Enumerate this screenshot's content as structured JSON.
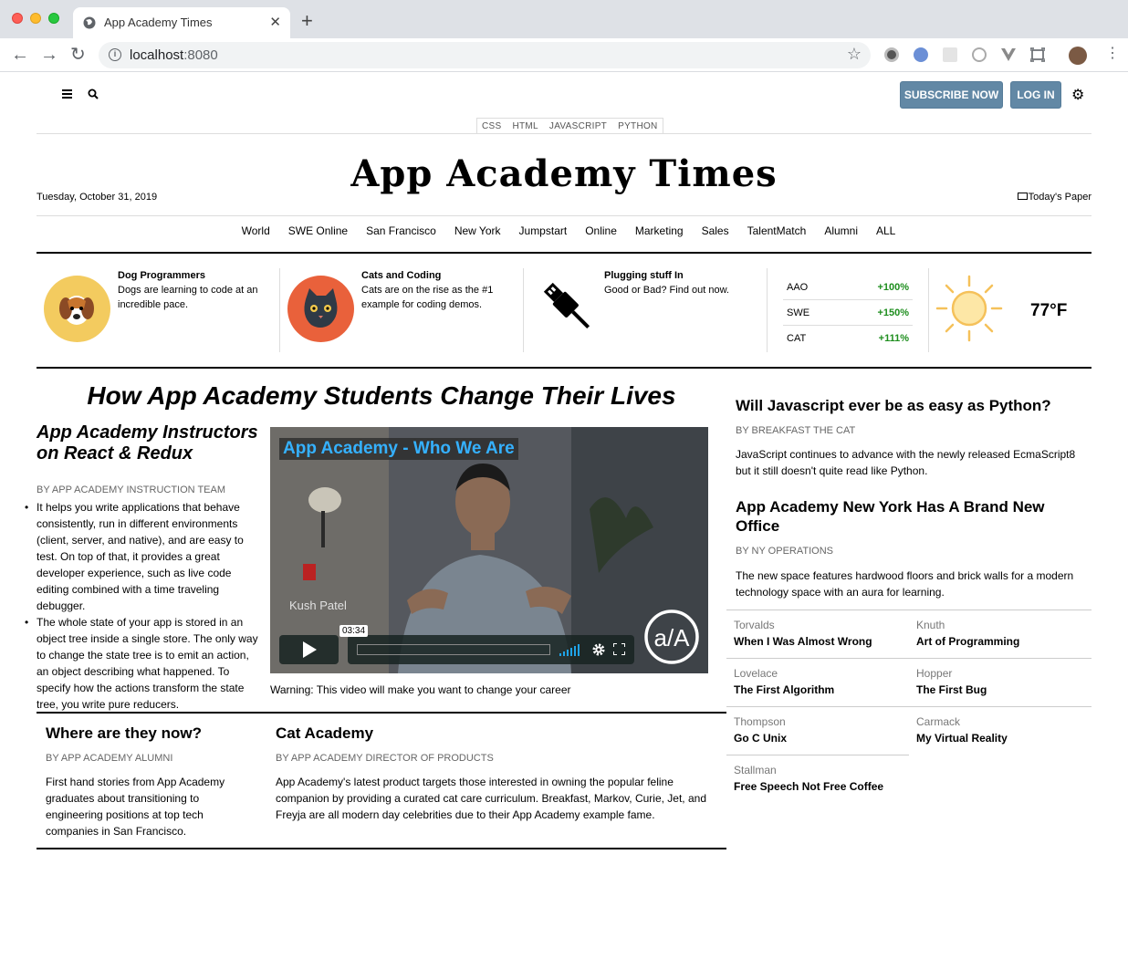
{
  "browser": {
    "tab_title": "App Academy Times",
    "tab_close": "✕",
    "new_tab": "+",
    "url_host": "localhost",
    "url_port": ":8080",
    "back": "←",
    "forward": "→",
    "reload": "↻",
    "star": "☆",
    "menu": "⋮"
  },
  "header": {
    "menu_icon": "≡",
    "search_icon": "⌕",
    "subscribe_label": "SUBSCRIBE NOW",
    "login_label": "LOG IN",
    "settings_icon": "⚙"
  },
  "languages": [
    "CSS",
    "HTML",
    "JAVASCRIPT",
    "PYTHON"
  ],
  "masthead": {
    "title": "App Academy Times",
    "date": "Tuesday, October 31, 2019",
    "todays_paper": "Today's Paper"
  },
  "sections": [
    "World",
    "SWE Online",
    "San Francisco",
    "New York",
    "Jumpstart",
    "Online",
    "Marketing",
    "Sales",
    "TalentMatch",
    "Alumni",
    "ALL"
  ],
  "strip": [
    {
      "title": "Dog Programmers",
      "desc": "Dogs are learning to code at an incredible pace.",
      "icon": "dog-icon"
    },
    {
      "title": "Cats and Coding",
      "desc": "Cats are on the rise as the #1 example for coding demos.",
      "icon": "cat-icon"
    },
    {
      "title": "Plugging stuff In",
      "desc": "Good or Bad? Find out now.",
      "icon": "usb-plug-icon"
    }
  ],
  "markets": [
    {
      "ticker": "AAO",
      "change": "+100%"
    },
    {
      "ticker": "SWE",
      "change": "+150%"
    },
    {
      "ticker": "CAT",
      "change": "+111%"
    }
  ],
  "weather": {
    "temp": "77°F",
    "icon": "sun-icon"
  },
  "main": {
    "headline": "How App Academy Students Change Their Lives",
    "sub_headline": "App Academy Instructors on React & Redux",
    "byline": "By APP ACADEMY INSTRUCTION TEAM",
    "bullets": [
      "It helps you write applications that behave consistently, run in different environments (client, server, and native), and are easy to test. On top of that, it provides a great developer experience, such as live code editing combined with a time traveling debugger.",
      "The whole state of your app is stored in an object tree inside a single store. The only way to change the state tree is to emit an action, an object describing what happened. To specify how the actions transform the state tree, you write pure reducers."
    ],
    "video": {
      "title": "App Academy - Who We Are",
      "speaker": "Kush Patel",
      "timecode": "03:34",
      "logo": "a/A",
      "caption": "Warning: This video will make you want to change your career"
    }
  },
  "bottom_articles": [
    {
      "title": "Where are they now?",
      "byline": "By APP ACADEMY ALUMNI",
      "body": "First hand stories from App Academy graduates about transitioning to engineering positions at top tech companies in San Francisco."
    },
    {
      "title": "Cat Academy",
      "byline": "By APP ACADEMY DIRECTOR OF PRODUCTS",
      "body": "App Academy's latest product targets those interested in owning the popular feline companion by providing a curated cat care curriculum. Breakfast, Markov, Curie, Jet, and Freyja are all modern day celebrities due to their App Academy example fame."
    }
  ],
  "sidebar_articles": [
    {
      "title": "Will Javascript ever be as easy as Python?",
      "byline": "By BREAKFAST THE CAT",
      "body": "JavaScript continues to advance with the newly released EcmaScript8 but it still doesn't quite read like Python."
    },
    {
      "title": "App Academy New York Has A Brand New Office",
      "byline": "By NY OPERATIONS",
      "body": "The new space features hardwood floors and brick walls for a modern technology space with an aura for learning."
    }
  ],
  "people": [
    {
      "name": "Torvalds",
      "work": "When I Was Almost Wrong"
    },
    {
      "name": "Knuth",
      "work": "Art of Programming"
    },
    {
      "name": "Lovelace",
      "work": "The First Algorithm"
    },
    {
      "name": "Hopper",
      "work": "The First Bug"
    },
    {
      "name": "Thompson",
      "work": "Go C Unix"
    },
    {
      "name": "Carmack",
      "work": "My Virtual Reality"
    },
    {
      "name": "Stallman",
      "work": "Free Speech Not Free Coffee"
    }
  ]
}
